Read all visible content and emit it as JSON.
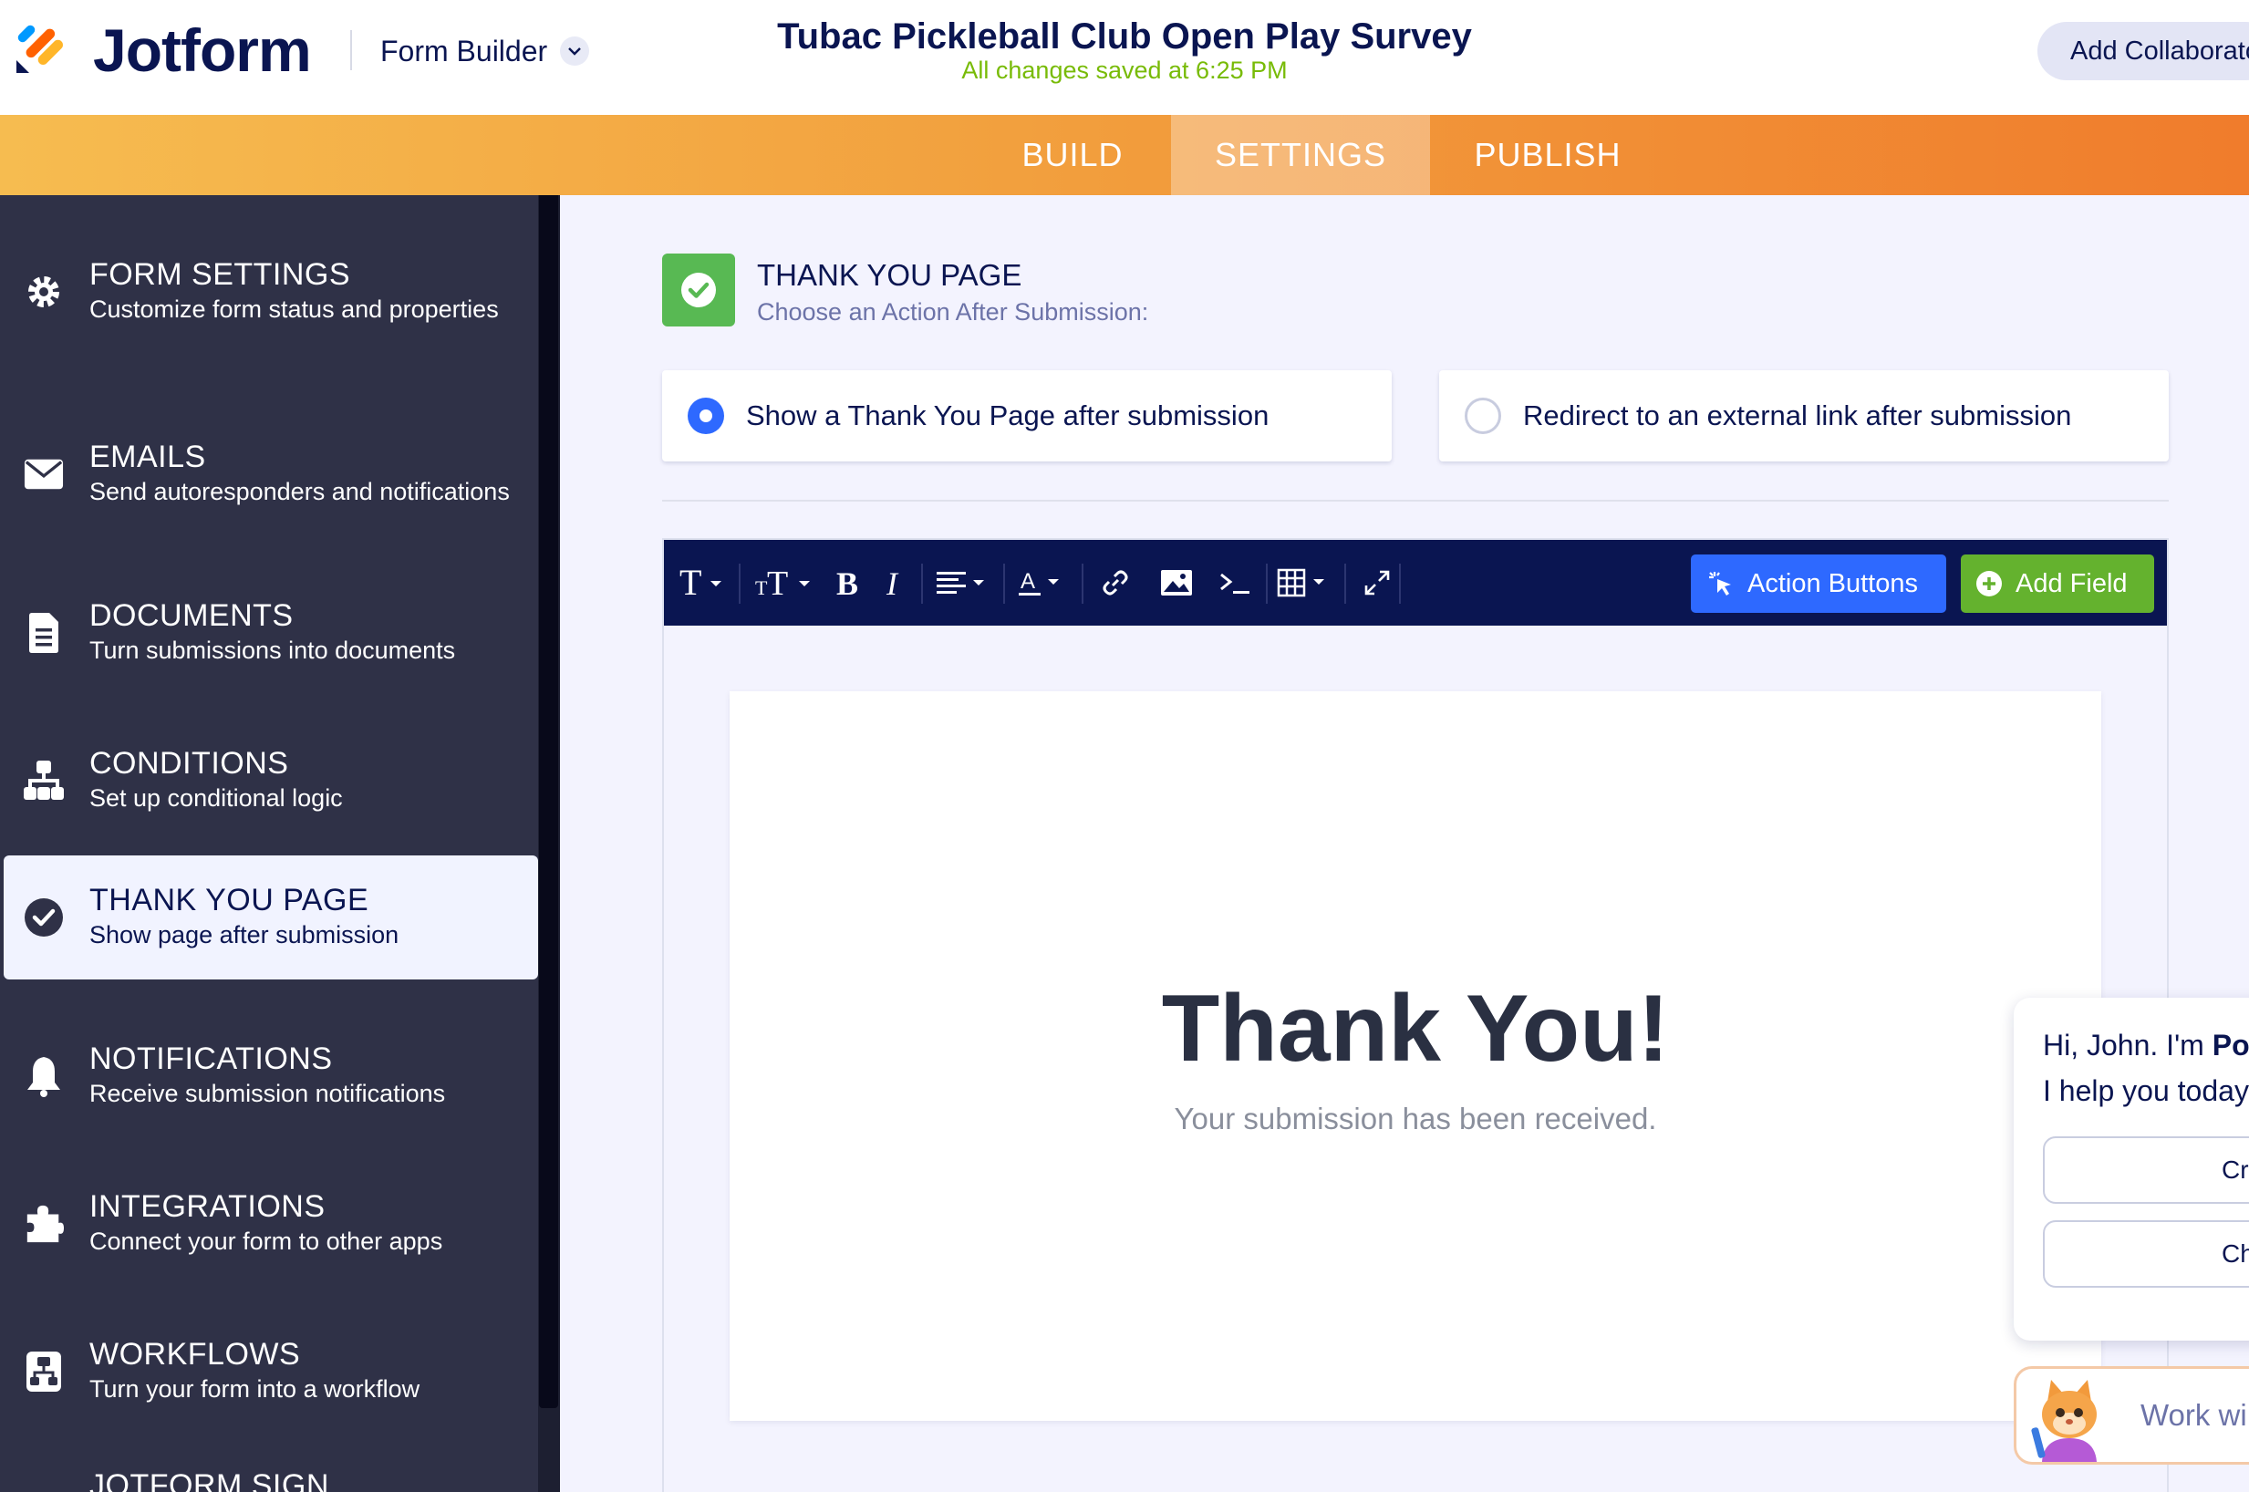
{
  "header": {
    "brand": "Jotform",
    "form_builder_label": "Form Builder",
    "form_title": "Tubac Pickleball Club Open Play Survey",
    "save_status": "All changes saved at 6:25 PM",
    "collab_label": "Add Collaborators"
  },
  "nav": {
    "build": "BUILD",
    "settings": "SETTINGS",
    "publish": "PUBLISH"
  },
  "sidebar": {
    "items": [
      {
        "title": "FORM SETTINGS",
        "subtitle": "Customize form status and properties",
        "icon": "gear-icon"
      },
      {
        "title": "EMAILS",
        "subtitle": "Send autoresponders and notifications",
        "icon": "envelope-icon"
      },
      {
        "title": "DOCUMENTS",
        "subtitle": "Turn submissions into documents",
        "icon": "document-icon"
      },
      {
        "title": "CONDITIONS",
        "subtitle": "Set up conditional logic",
        "icon": "sitemap-icon"
      },
      {
        "title": "THANK YOU PAGE",
        "subtitle": "Show page after submission",
        "icon": "check-circle-icon"
      },
      {
        "title": "NOTIFICATIONS",
        "subtitle": "Receive submission notifications",
        "icon": "bell-icon"
      },
      {
        "title": "INTEGRATIONS",
        "subtitle": "Connect your form to other apps",
        "icon": "puzzle-icon"
      },
      {
        "title": "WORKFLOWS",
        "subtitle": "Turn your form into a workflow",
        "icon": "workflow-icon"
      },
      {
        "title": "JOTFORM SIGN",
        "subtitle": "",
        "icon": ""
      }
    ]
  },
  "main": {
    "title": "THANK YOU PAGE",
    "subtitle": "Choose an Action After Submission:",
    "option_show": "Show a Thank You Page after submission",
    "option_redirect": "Redirect to an external link after submission",
    "selected_option": "Show a Thank You Page after submission"
  },
  "toolbar": {
    "action_buttons": "Action Buttons",
    "add_field": "Add Field",
    "tools": [
      "font-icon",
      "text-size-icon",
      "bold-icon",
      "italic-icon",
      "align-icon",
      "font-color-icon",
      "link-icon",
      "image-icon",
      "variable-icon",
      "table-icon",
      "expand-icon"
    ]
  },
  "canvas": {
    "heading": "Thank You!",
    "subtext": "Your submission has been received."
  },
  "chat": {
    "greeting_prefix": "Hi, John. I'm ",
    "agent_name": "Po",
    "greeting_line2": "I help you today",
    "btn1": "Cre",
    "btn2": "Ch",
    "agent_pill": "Work wi"
  },
  "colors": {
    "brand_navy": "#0a1551",
    "save_green": "#78bb07",
    "accent_blue": "#2e69ff",
    "add_green": "#64b22e",
    "sidebar_bg": "#2f3147",
    "nav_orange_start": "#f6bc50",
    "nav_orange_end": "#f07c2c"
  }
}
